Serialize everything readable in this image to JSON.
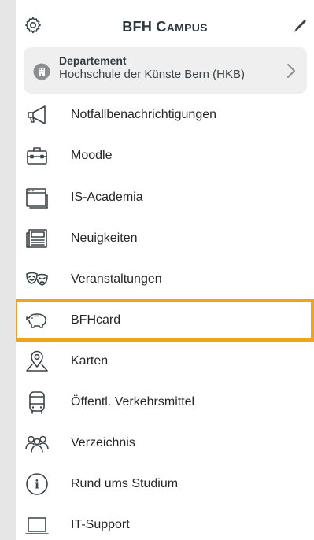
{
  "header": {
    "title_prefix": "BFH C",
    "title_small": "AMPUS"
  },
  "department": {
    "label": "Departement",
    "value": "Hochschule der Künste Bern (HKB)"
  },
  "menu": [
    {
      "label": "Notfallbenachrichtigungen",
      "icon": "megaphone-icon"
    },
    {
      "label": "Moodle",
      "icon": "briefcase-icon"
    },
    {
      "label": "IS-Academia",
      "icon": "browser-window-icon"
    },
    {
      "label": "Neuigkeiten",
      "icon": "newspaper-icon"
    },
    {
      "label": "Veranstaltungen",
      "icon": "theater-masks-icon"
    },
    {
      "label": "BFHcard",
      "icon": "piggy-bank-icon",
      "selected": true
    },
    {
      "label": "Karten",
      "icon": "map-pin-icon"
    },
    {
      "label": "Öffentl. Verkehrsmittel",
      "icon": "bus-icon"
    },
    {
      "label": "Verzeichnis",
      "icon": "people-icon"
    },
    {
      "label": "Rund ums Studium",
      "icon": "info-icon"
    },
    {
      "label": "IT-Support",
      "icon": "laptop-icon"
    }
  ],
  "colors": {
    "highlight_border": "#f0a418",
    "background": "#e6e6e6",
    "panel": "#ffffff",
    "department_box": "#efefef"
  }
}
